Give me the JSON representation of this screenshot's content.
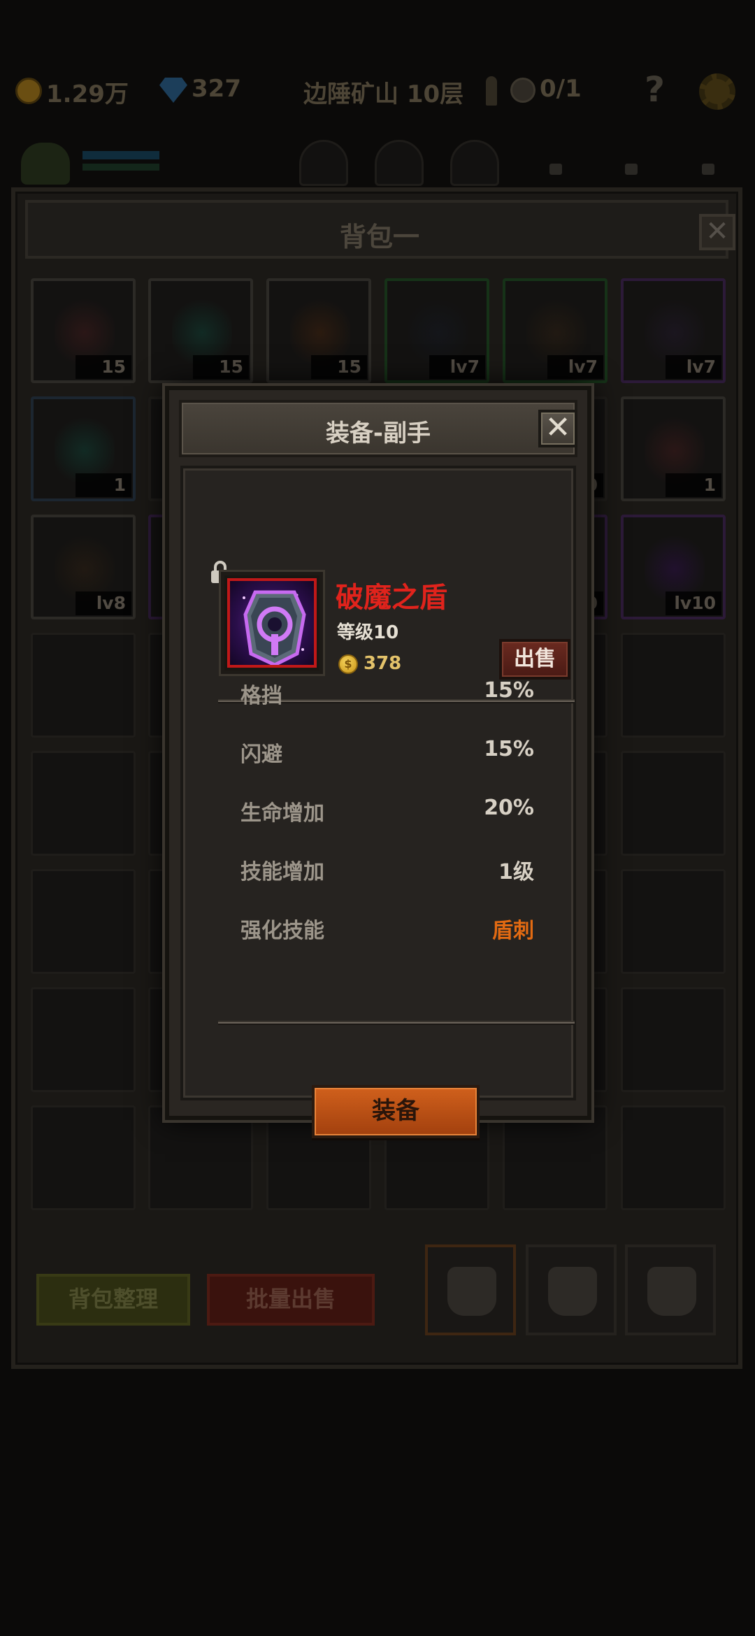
{
  "topbar": {
    "gold": "1.29万",
    "gems": "327",
    "location": "边陲矿山 10层",
    "keys": "0/1"
  },
  "bag": {
    "title": "背包一",
    "close_label": "✕",
    "cells": [
      {
        "count": "15",
        "color": "#3a1a1a",
        "border": "#2c2a26"
      },
      {
        "count": "15",
        "color": "#103a30",
        "border": "#2c2a26"
      },
      {
        "count": "15",
        "color": "#3a200e",
        "border": "#2c2a26"
      },
      {
        "count": "lv7",
        "color": "#141820",
        "border": "#163218"
      },
      {
        "count": "lv7",
        "color": "#2a1e12",
        "border": "#163218"
      },
      {
        "count": "lv7",
        "color": "#201828",
        "border": "#2c1a38"
      },
      {
        "count": "1",
        "color": "#103a30",
        "border": "#1c2630"
      },
      {
        "count": "",
        "color": "#151412",
        "border": "#1f1d1a"
      },
      {
        "count": "",
        "color": "#151412",
        "border": "#1f1d1a"
      },
      {
        "count": "",
        "color": "#151412",
        "border": "#1f1d1a"
      },
      {
        "count": "0",
        "color": "#151412",
        "border": "#1f1d1a"
      },
      {
        "count": "1",
        "color": "#3a1a1a",
        "border": "#2c2a26"
      },
      {
        "count": "lv8",
        "color": "#2a1e12",
        "border": "#2c2a26"
      },
      {
        "count": "",
        "color": "#201828",
        "border": "#2c1a38"
      },
      {
        "count": "",
        "color": "#151412",
        "border": "#1f1d1a"
      },
      {
        "count": "",
        "color": "#151412",
        "border": "#1f1d1a"
      },
      {
        "count": "0",
        "color": "#2a1a10",
        "border": "#2c1a38"
      },
      {
        "count": "lv10",
        "color": "#2a1040",
        "border": "#2c1a38"
      }
    ],
    "sort_label": "背包整理",
    "bulk_sell_label": "批量出售"
  },
  "modal": {
    "title": "装备-副手",
    "close_label": "✕",
    "item": {
      "name": "破魔之盾",
      "level": "等级10",
      "coin_symbol": "$",
      "price": "378",
      "sell_label": "出售"
    },
    "stats": [
      {
        "label": "格挡",
        "value": "15%"
      },
      {
        "label": "闪避",
        "value": "15%"
      },
      {
        "label": "生命增加",
        "value": "20%"
      },
      {
        "label": "技能增加",
        "value": "1级"
      },
      {
        "label": "强化技能",
        "value": "盾刺"
      }
    ],
    "equip_label": "装备"
  },
  "colors": {
    "item_name": "#e0231c",
    "highlight_value": "#e26a12",
    "equip_button": "#c0561a",
    "sell_button": "#5a2219"
  }
}
